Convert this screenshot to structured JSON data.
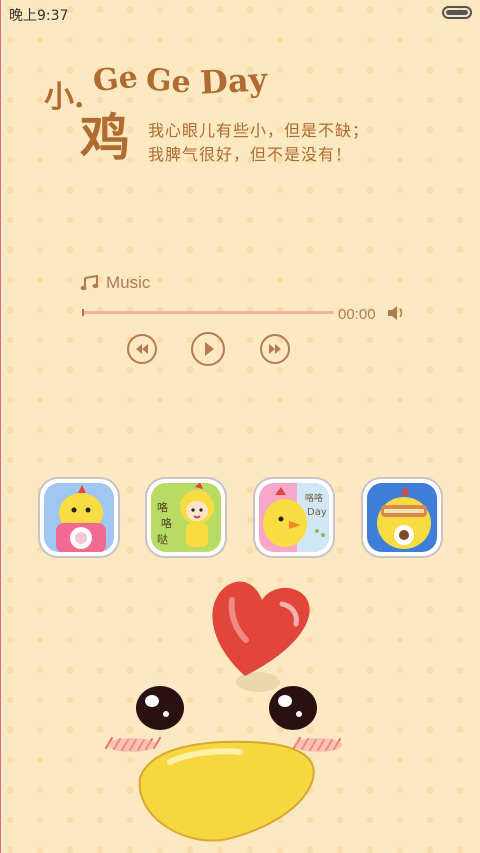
{
  "status_bar": {
    "time": "晚上9:37",
    "battery_icon": "battery-icon"
  },
  "header": {
    "title_prefix": "小.",
    "title_latin_1": "Ge",
    "title_latin_2": "Ge",
    "title_latin_3": "Day",
    "title_char": "鸡",
    "tagline_line1": "我心眼儿有些小，但是不缺；",
    "tagline_line2": "我脾气很好，但不是没有！"
  },
  "music_widget": {
    "icon": "music-note-icon",
    "label": "Music",
    "time": "00:00",
    "progress": 0,
    "controls": [
      "previous-button",
      "play-button",
      "next-button"
    ],
    "volume_icon": "speaker-icon"
  },
  "app_dock": {
    "apps": [
      {
        "name": "app-icon-1",
        "icon": "chick-camera-icon"
      },
      {
        "name": "app-icon-2",
        "icon": "chick-girl-icon",
        "text": "咯咯哒"
      },
      {
        "name": "app-icon-3",
        "icon": "chick-day-icon",
        "text": "咯咯Day"
      },
      {
        "name": "app-icon-4",
        "icon": "chick-sandwich-icon"
      }
    ]
  },
  "colors": {
    "background": "#fde9c1",
    "title": "#b06b33",
    "accent": "#e2463a",
    "beak": "#f7d73f"
  }
}
